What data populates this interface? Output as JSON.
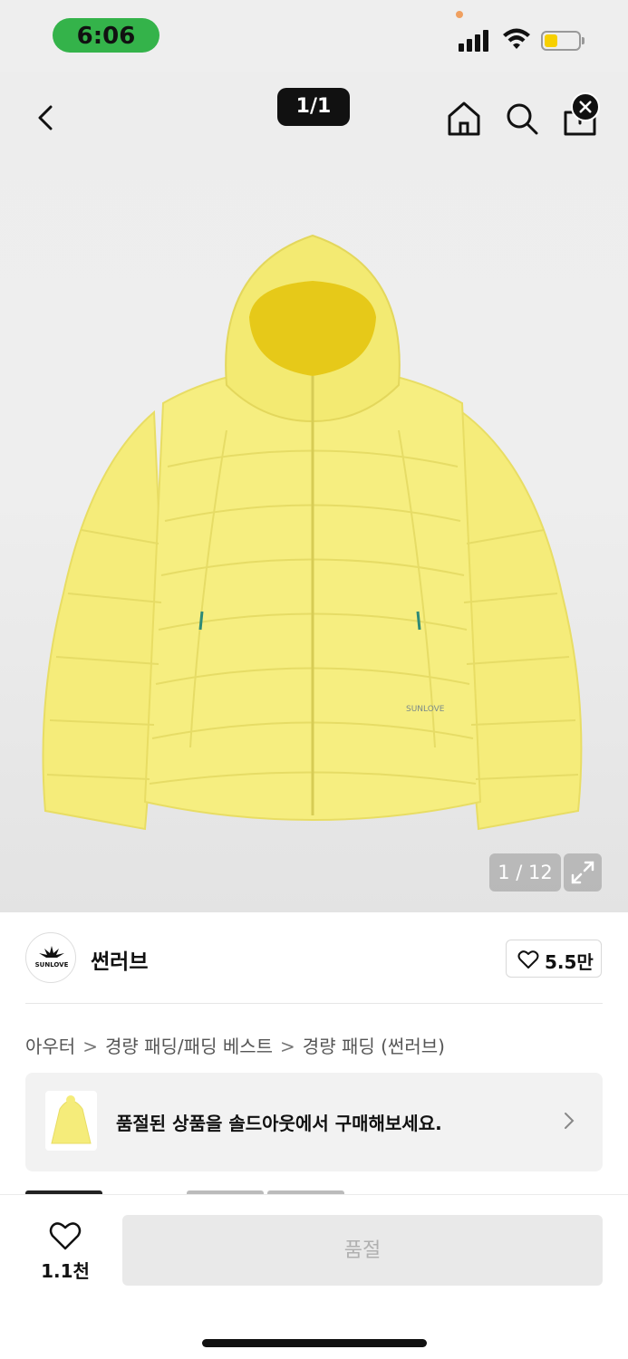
{
  "status_bar": {
    "time": "6:06",
    "battery_color": "#f7d000",
    "time_pill_color": "#34b34a"
  },
  "header": {
    "page_indicator": "1/1",
    "icons": [
      "back-icon",
      "home-icon",
      "search-icon",
      "share-icon",
      "close-icon"
    ]
  },
  "gallery": {
    "counter": "1 / 12",
    "brand_mark_text": "SUNLOVE"
  },
  "brand": {
    "name": "썬러브",
    "logo_text": "SUNLOVE",
    "like_count": "5.5만"
  },
  "breadcrumb": {
    "items": [
      "아우터",
      "경량 패딩/패딩 베스트",
      "경량 패딩 (썬러브)"
    ],
    "separator": ">"
  },
  "soldout_banner": {
    "text": "품절된 상품을 솔드아웃에서 구매해보세요."
  },
  "bottom_bar": {
    "wish_count": "1.1천",
    "buy_label": "품절"
  },
  "colors": {
    "jacket": "#f5ec7a",
    "accent_dark": "#111111"
  }
}
